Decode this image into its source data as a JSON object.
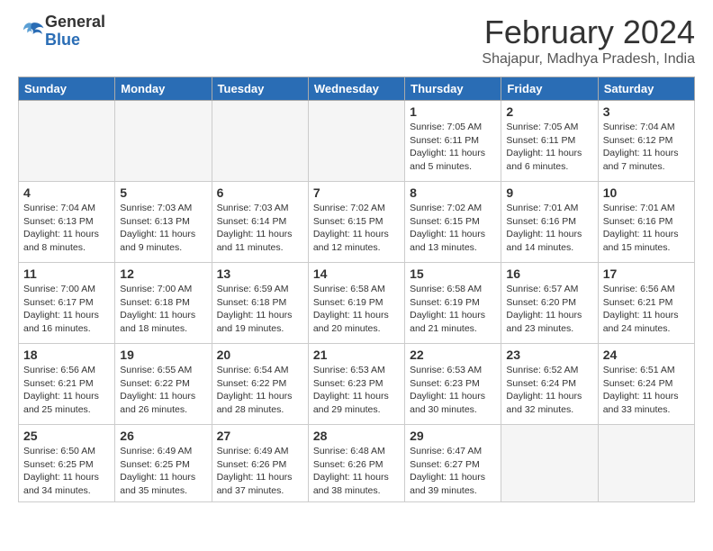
{
  "header": {
    "logo_general": "General",
    "logo_blue": "Blue",
    "month_title": "February 2024",
    "location": "Shajapur, Madhya Pradesh, India"
  },
  "days_of_week": [
    "Sunday",
    "Monday",
    "Tuesday",
    "Wednesday",
    "Thursday",
    "Friday",
    "Saturday"
  ],
  "weeks": [
    [
      {
        "day": "",
        "info": ""
      },
      {
        "day": "",
        "info": ""
      },
      {
        "day": "",
        "info": ""
      },
      {
        "day": "",
        "info": ""
      },
      {
        "day": "1",
        "info": "Sunrise: 7:05 AM\nSunset: 6:11 PM\nDaylight: 11 hours and 5 minutes."
      },
      {
        "day": "2",
        "info": "Sunrise: 7:05 AM\nSunset: 6:11 PM\nDaylight: 11 hours and 6 minutes."
      },
      {
        "day": "3",
        "info": "Sunrise: 7:04 AM\nSunset: 6:12 PM\nDaylight: 11 hours and 7 minutes."
      }
    ],
    [
      {
        "day": "4",
        "info": "Sunrise: 7:04 AM\nSunset: 6:13 PM\nDaylight: 11 hours and 8 minutes."
      },
      {
        "day": "5",
        "info": "Sunrise: 7:03 AM\nSunset: 6:13 PM\nDaylight: 11 hours and 9 minutes."
      },
      {
        "day": "6",
        "info": "Sunrise: 7:03 AM\nSunset: 6:14 PM\nDaylight: 11 hours and 11 minutes."
      },
      {
        "day": "7",
        "info": "Sunrise: 7:02 AM\nSunset: 6:15 PM\nDaylight: 11 hours and 12 minutes."
      },
      {
        "day": "8",
        "info": "Sunrise: 7:02 AM\nSunset: 6:15 PM\nDaylight: 11 hours and 13 minutes."
      },
      {
        "day": "9",
        "info": "Sunrise: 7:01 AM\nSunset: 6:16 PM\nDaylight: 11 hours and 14 minutes."
      },
      {
        "day": "10",
        "info": "Sunrise: 7:01 AM\nSunset: 6:16 PM\nDaylight: 11 hours and 15 minutes."
      }
    ],
    [
      {
        "day": "11",
        "info": "Sunrise: 7:00 AM\nSunset: 6:17 PM\nDaylight: 11 hours and 16 minutes."
      },
      {
        "day": "12",
        "info": "Sunrise: 7:00 AM\nSunset: 6:18 PM\nDaylight: 11 hours and 18 minutes."
      },
      {
        "day": "13",
        "info": "Sunrise: 6:59 AM\nSunset: 6:18 PM\nDaylight: 11 hours and 19 minutes."
      },
      {
        "day": "14",
        "info": "Sunrise: 6:58 AM\nSunset: 6:19 PM\nDaylight: 11 hours and 20 minutes."
      },
      {
        "day": "15",
        "info": "Sunrise: 6:58 AM\nSunset: 6:19 PM\nDaylight: 11 hours and 21 minutes."
      },
      {
        "day": "16",
        "info": "Sunrise: 6:57 AM\nSunset: 6:20 PM\nDaylight: 11 hours and 23 minutes."
      },
      {
        "day": "17",
        "info": "Sunrise: 6:56 AM\nSunset: 6:21 PM\nDaylight: 11 hours and 24 minutes."
      }
    ],
    [
      {
        "day": "18",
        "info": "Sunrise: 6:56 AM\nSunset: 6:21 PM\nDaylight: 11 hours and 25 minutes."
      },
      {
        "day": "19",
        "info": "Sunrise: 6:55 AM\nSunset: 6:22 PM\nDaylight: 11 hours and 26 minutes."
      },
      {
        "day": "20",
        "info": "Sunrise: 6:54 AM\nSunset: 6:22 PM\nDaylight: 11 hours and 28 minutes."
      },
      {
        "day": "21",
        "info": "Sunrise: 6:53 AM\nSunset: 6:23 PM\nDaylight: 11 hours and 29 minutes."
      },
      {
        "day": "22",
        "info": "Sunrise: 6:53 AM\nSunset: 6:23 PM\nDaylight: 11 hours and 30 minutes."
      },
      {
        "day": "23",
        "info": "Sunrise: 6:52 AM\nSunset: 6:24 PM\nDaylight: 11 hours and 32 minutes."
      },
      {
        "day": "24",
        "info": "Sunrise: 6:51 AM\nSunset: 6:24 PM\nDaylight: 11 hours and 33 minutes."
      }
    ],
    [
      {
        "day": "25",
        "info": "Sunrise: 6:50 AM\nSunset: 6:25 PM\nDaylight: 11 hours and 34 minutes."
      },
      {
        "day": "26",
        "info": "Sunrise: 6:49 AM\nSunset: 6:25 PM\nDaylight: 11 hours and 35 minutes."
      },
      {
        "day": "27",
        "info": "Sunrise: 6:49 AM\nSunset: 6:26 PM\nDaylight: 11 hours and 37 minutes."
      },
      {
        "day": "28",
        "info": "Sunrise: 6:48 AM\nSunset: 6:26 PM\nDaylight: 11 hours and 38 minutes."
      },
      {
        "day": "29",
        "info": "Sunrise: 6:47 AM\nSunset: 6:27 PM\nDaylight: 11 hours and 39 minutes."
      },
      {
        "day": "",
        "info": ""
      },
      {
        "day": "",
        "info": ""
      }
    ]
  ]
}
